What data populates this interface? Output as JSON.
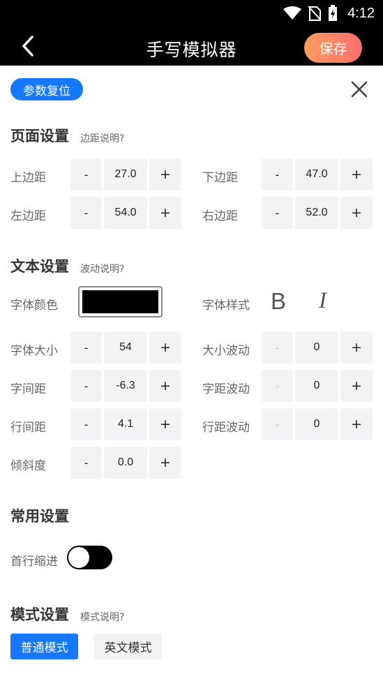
{
  "status_bar": {
    "time": "4:12"
  },
  "header": {
    "title": "手写模拟器",
    "save_label": "保存"
  },
  "reset_label": "参数复位",
  "page_settings": {
    "title": "页面设置",
    "hint": "边距说明?",
    "fields": [
      {
        "label": "上边距",
        "value": "27.0"
      },
      {
        "label": "下边距",
        "value": "47.0"
      },
      {
        "label": "左边距",
        "value": "54.0"
      },
      {
        "label": "右边距",
        "value": "52.0"
      }
    ]
  },
  "text_settings": {
    "title": "文本设置",
    "hint": "波动说明?",
    "font_color_label": "字体颜色",
    "font_color": "#000000",
    "font_style_label": "字体样式",
    "bold_glyph": "B",
    "italic_glyph": "I",
    "fields": [
      {
        "label": "字体大小",
        "value": "54"
      },
      {
        "label": "大小波动",
        "value": "0"
      },
      {
        "label": "字间距",
        "value": "-6.3"
      },
      {
        "label": "字距波动",
        "value": "0"
      },
      {
        "label": "行间距",
        "value": "4.1"
      },
      {
        "label": "行距波动",
        "value": "0"
      },
      {
        "label": "倾斜度",
        "value": "0.0"
      }
    ]
  },
  "common_settings": {
    "title": "常用设置",
    "indent_label": "首行缩进",
    "indent_enabled": false
  },
  "mode_settings": {
    "title": "模式设置",
    "hint": "模式说明?",
    "modes": [
      "普通模式",
      "英文模式"
    ],
    "selected": "普通模式"
  },
  "stepper": {
    "minus": "-",
    "plus": "+"
  },
  "colors": {
    "accent": "#1677ff",
    "save_gradient_start": "#ff9a5e",
    "save_gradient_end": "#ff6f6f"
  }
}
